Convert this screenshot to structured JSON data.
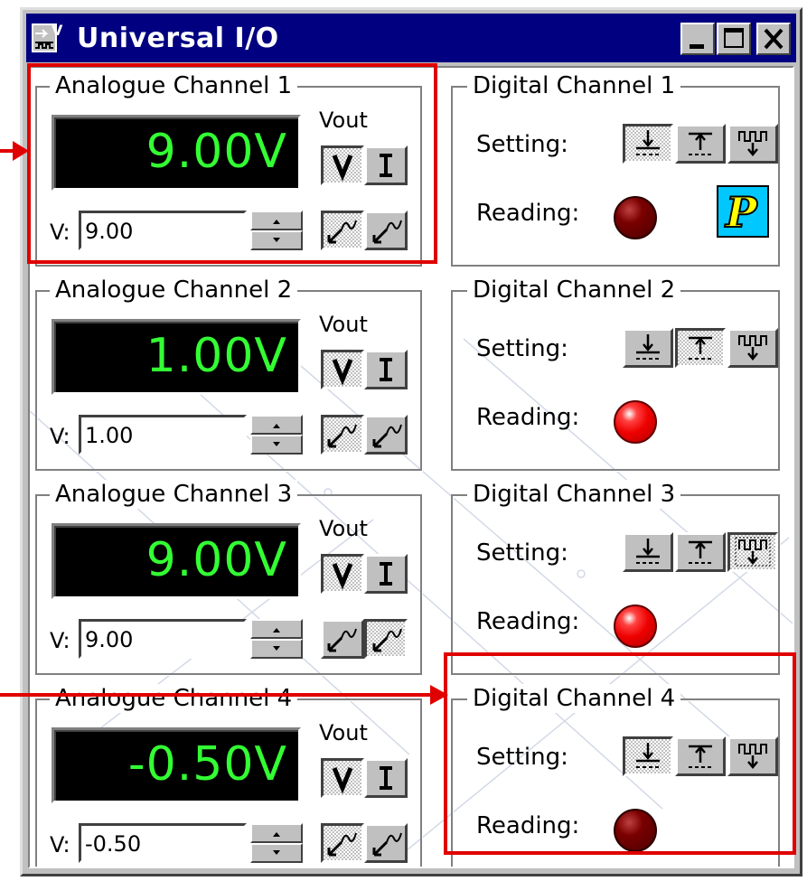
{
  "window": {
    "title": "Universal I/O"
  },
  "analogue_channels": [
    {
      "title": "Analogue Channel 1",
      "display": "9.00V",
      "vout_label": "Vout",
      "v_label": "V:",
      "value": "9.00",
      "mode": "V",
      "ramp": "up"
    },
    {
      "title": "Analogue Channel 2",
      "display": "1.00V",
      "vout_label": "Vout",
      "v_label": "V:",
      "value": "1.00",
      "mode": "V",
      "ramp": "up"
    },
    {
      "title": "Analogue Channel 3",
      "display": "9.00V",
      "vout_label": "Vout",
      "v_label": "V:",
      "value": "9.00",
      "mode": "V",
      "ramp": "down"
    },
    {
      "title": "Analogue Channel 4",
      "display": "-0.50V",
      "vout_label": "Vout",
      "v_label": "V:",
      "value": "-0.50",
      "mode": "V",
      "ramp": "up"
    }
  ],
  "digital_channels": [
    {
      "title": "Digital Channel 1",
      "setting_label": "Setting:",
      "reading_label": "Reading:",
      "setting": "low",
      "reading": "off"
    },
    {
      "title": "Digital Channel 2",
      "setting_label": "Setting:",
      "reading_label": "Reading:",
      "setting": "high",
      "reading": "on"
    },
    {
      "title": "Digital Channel 3",
      "setting_label": "Setting:",
      "reading_label": "Reading:",
      "setting": "pulse",
      "reading": "on"
    },
    {
      "title": "Digital Channel 4",
      "setting_label": "Setting:",
      "reading_label": "Reading:",
      "setting": "low",
      "reading": "off"
    }
  ],
  "icons": {
    "app": "universal-io-app-icon",
    "logo": "p-logo-icon"
  },
  "colors": {
    "lcd_text": "#33ff33",
    "highlight": "#e00000",
    "titlebar": "#000080",
    "led_on": "#ee0000",
    "led_off": "#6a0000"
  }
}
